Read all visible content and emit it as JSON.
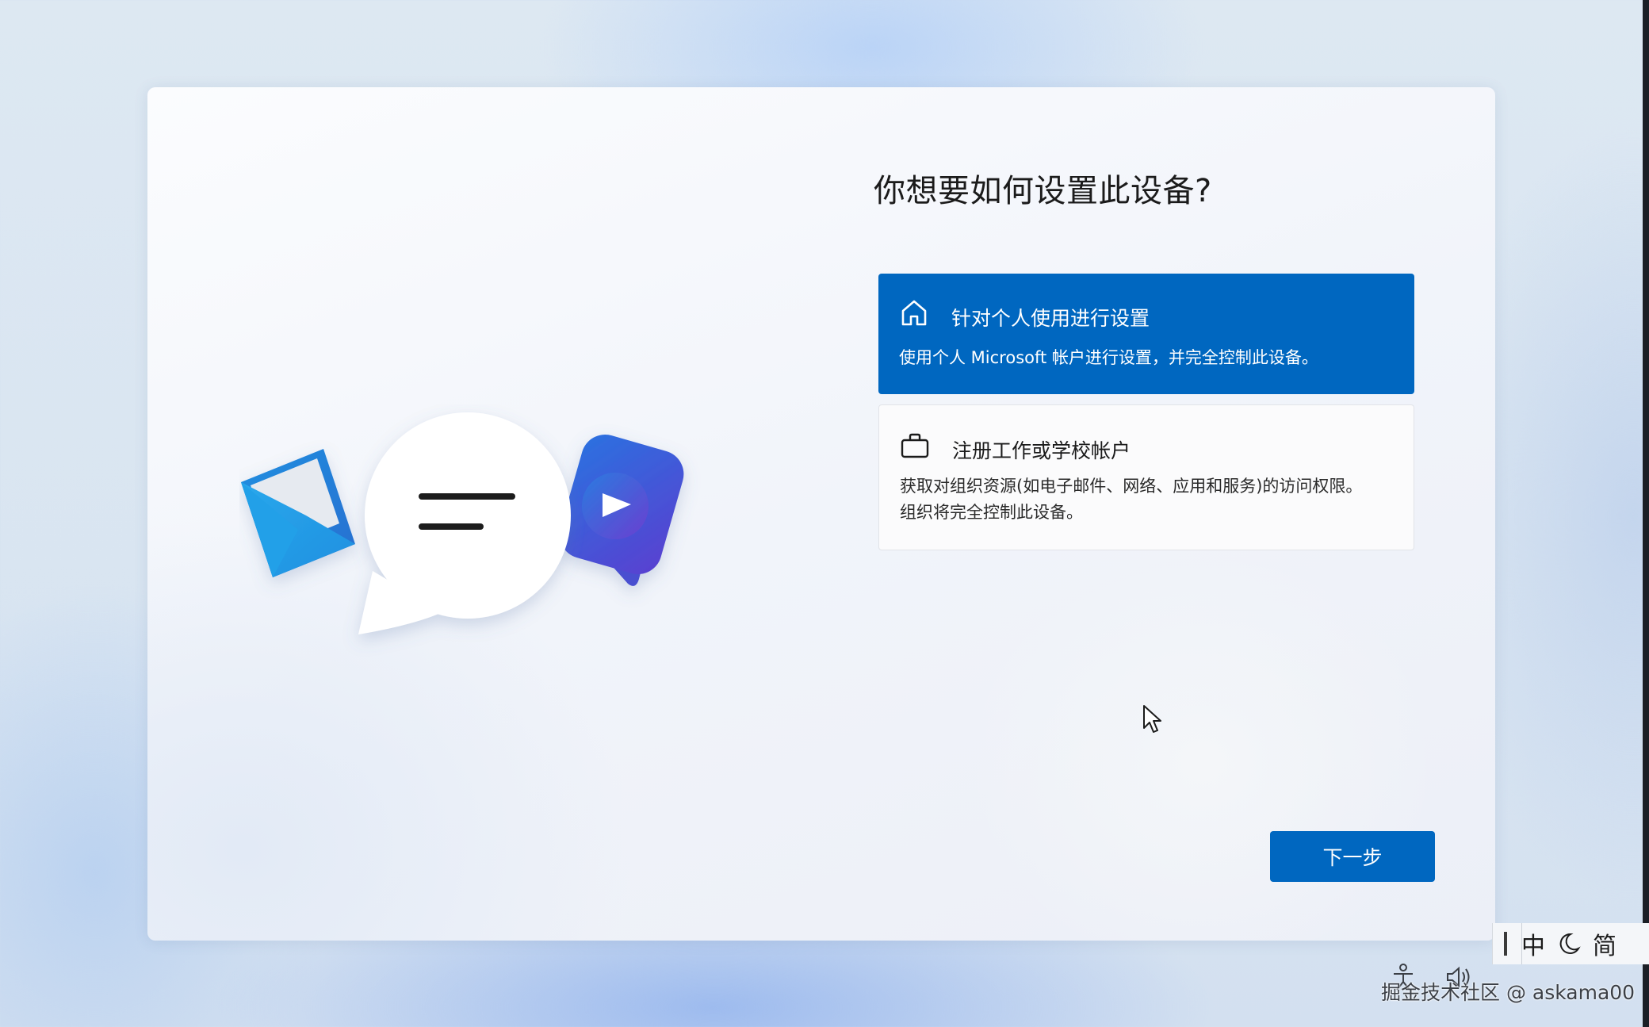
{
  "setup": {
    "title": "你想要如何设置此设备?",
    "options": [
      {
        "icon": "home-icon",
        "title": "针对个人使用进行设置",
        "description": "使用个人 Microsoft 帐户进行设置，并完全控制此设备。",
        "selected": true
      },
      {
        "icon": "briefcase-icon",
        "title": "注册工作或学校帐户",
        "description": "获取对组织资源(如电子邮件、网络、应用和服务)的访问权限。组织将完全控制此设备。",
        "selected": false
      }
    ],
    "next_label": "下一步"
  },
  "ime": {
    "mode": "中",
    "script": "简"
  },
  "watermark": "掘金技术社区 @ askama00",
  "colors": {
    "accent": "#0067c0",
    "accent_text": "#ffffff"
  }
}
